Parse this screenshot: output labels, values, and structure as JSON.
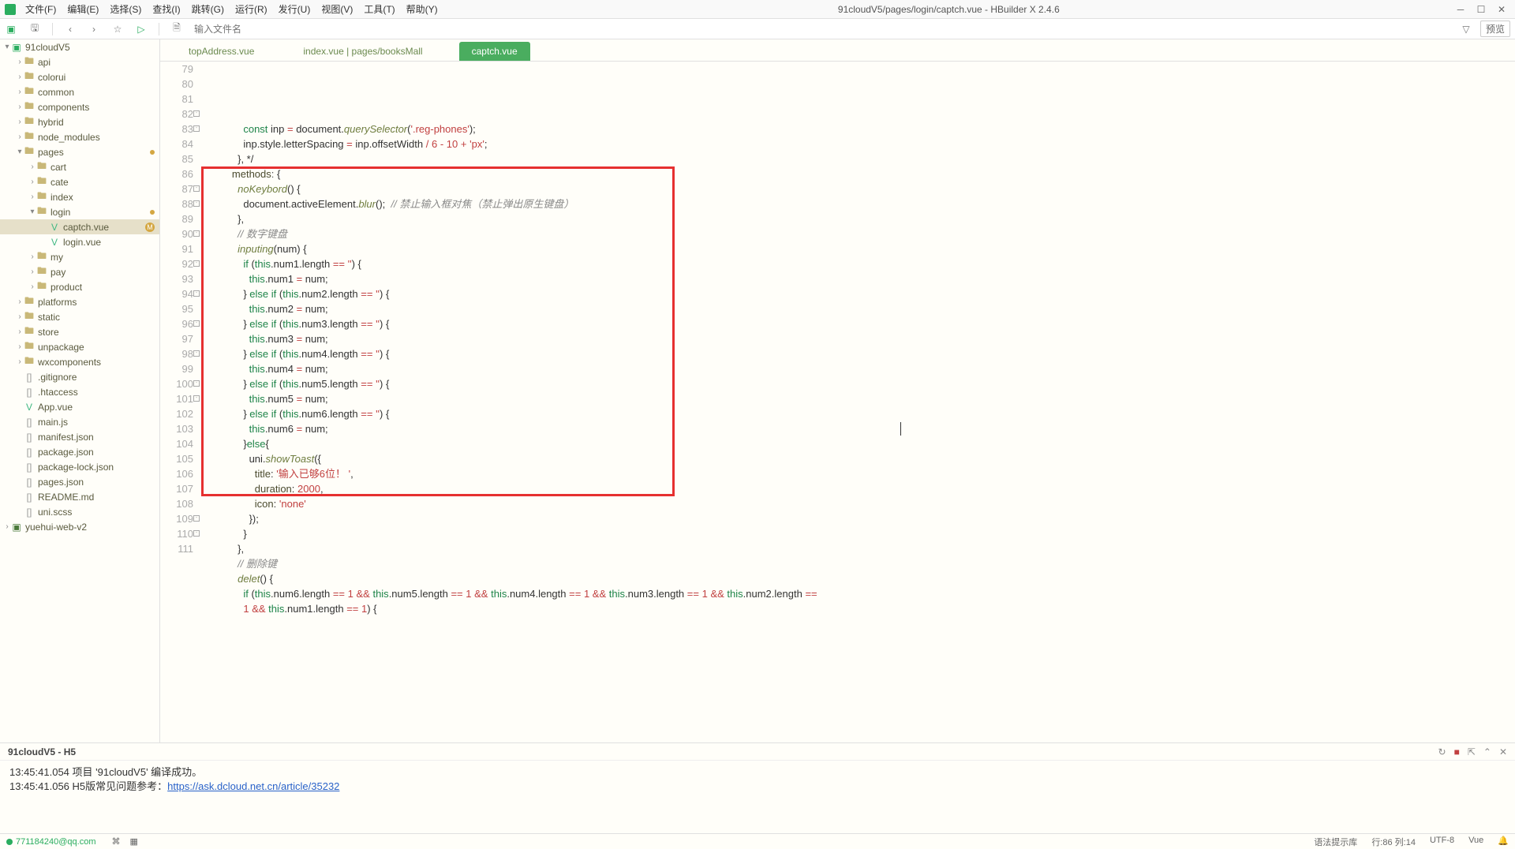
{
  "window": {
    "title": "91cloudV5/pages/login/captch.vue - HBuilder X 2.4.6"
  },
  "menu": {
    "file": "文件(F)",
    "edit": "编辑(E)",
    "select": "选择(S)",
    "find": "查找(I)",
    "goto": "跳转(G)",
    "run": "运行(R)",
    "publish": "发行(U)",
    "view": "视图(V)",
    "tools": "工具(T)",
    "help": "帮助(Y)"
  },
  "toolbar": {
    "search_placeholder": "输入文件名",
    "preview": "预览"
  },
  "tree": {
    "root": "91cloudV5",
    "api": "api",
    "colorui": "colorui",
    "common": "common",
    "components": "components",
    "hybrid": "hybrid",
    "node_modules": "node_modules",
    "pages": "pages",
    "cart": "cart",
    "cate": "cate",
    "index": "index",
    "login": "login",
    "captch": "captch.vue",
    "loginvue": "login.vue",
    "my": "my",
    "pay": "pay",
    "product": "product",
    "platforms": "platforms",
    "static": "static",
    "store": "store",
    "unpackage": "unpackage",
    "wxcomponents": "wxcomponents",
    "gitignore": ".gitignore",
    "htaccess": ".htaccess",
    "appvue": "App.vue",
    "mainjs": "main.js",
    "manifest": "manifest.json",
    "packagejson": "package.json",
    "packagelock": "package-lock.json",
    "pagesjson": "pages.json",
    "readme": "README.md",
    "uniscss": "uni.scss",
    "yuehui": "yuehui-web-v2"
  },
  "tabs": {
    "t1": "topAddress.vue",
    "t2": "index.vue | pages/booksMall",
    "t3": "captch.vue"
  },
  "code": {
    "lines": [
      {
        "n": 79,
        "html": "            <span class='kw'>const</span> inp <span class='op'>=</span> document.<span class='fn'>querySelector</span>(<span class='str'>'.reg-phones'</span>);"
      },
      {
        "n": 80,
        "html": "            inp.style.letterSpacing <span class='op'>=</span> inp.offsetWidth <span class='op'>/</span> <span class='num'>6</span> <span class='op'>-</span> <span class='num'>10</span> <span class='op'>+</span> <span class='str'>'px'</span>;"
      },
      {
        "n": 81,
        "html": "          }, */"
      },
      {
        "n": 82,
        "fold": true,
        "html": "        <span class='prop'>methods</span><span class='punct'>:</span> {"
      },
      {
        "n": 83,
        "fold": true,
        "html": "          <span class='fn'>noKeybord</span>() {"
      },
      {
        "n": 84,
        "html": "            document.activeElement.<span class='fn'>blur</span>();  <span class='cmt'>// 禁止输入框对焦（禁止弹出原生键盘）</span>"
      },
      {
        "n": 85,
        "html": "          },"
      },
      {
        "n": 86,
        "html": "          <span class='cmt'>// 数字键盘</span>"
      },
      {
        "n": 87,
        "fold": true,
        "html": "          <span class='fn'>inputing</span>(num) {"
      },
      {
        "n": 88,
        "fold": true,
        "html": "            <span class='kw'>if</span> (<span class='this'>this</span>.num1.length <span class='op'>==</span> <span class='str'>''</span>) {"
      },
      {
        "n": 89,
        "html": "              <span class='this'>this</span>.num1 <span class='op'>=</span> num;"
      },
      {
        "n": 90,
        "fold": true,
        "html": "            } <span class='kw'>else</span> <span class='kw'>if</span> (<span class='this'>this</span>.num2.length <span class='op'>==</span> <span class='str'>''</span>) {"
      },
      {
        "n": 91,
        "html": "              <span class='this'>this</span>.num2 <span class='op'>=</span> num;"
      },
      {
        "n": 92,
        "fold": true,
        "html": "            } <span class='kw'>else</span> <span class='kw'>if</span> (<span class='this'>this</span>.num3.length <span class='op'>==</span> <span class='str'>''</span>) {"
      },
      {
        "n": 93,
        "html": "              <span class='this'>this</span>.num3 <span class='op'>=</span> num;"
      },
      {
        "n": 94,
        "fold": true,
        "html": "            } <span class='kw'>else</span> <span class='kw'>if</span> (<span class='this'>this</span>.num4.length <span class='op'>==</span> <span class='str'>''</span>) {"
      },
      {
        "n": 95,
        "html": "              <span class='this'>this</span>.num4 <span class='op'>=</span> num;"
      },
      {
        "n": 96,
        "fold": true,
        "html": "            } <span class='kw'>else</span> <span class='kw'>if</span> (<span class='this'>this</span>.num5.length <span class='op'>==</span> <span class='str'>''</span>) {"
      },
      {
        "n": 97,
        "html": "              <span class='this'>this</span>.num5 <span class='op'>=</span> num;"
      },
      {
        "n": 98,
        "fold": true,
        "html": "            } <span class='kw'>else</span> <span class='kw'>if</span> (<span class='this'>this</span>.num6.length <span class='op'>==</span> <span class='str'>''</span>) {"
      },
      {
        "n": 99,
        "html": "              <span class='this'>this</span>.num6 <span class='op'>=</span> num;"
      },
      {
        "n": 100,
        "fold": true,
        "html": "            }<span class='kw'>else</span>{"
      },
      {
        "n": 101,
        "fold": true,
        "html": "              uni.<span class='fn'>showToast</span>({"
      },
      {
        "n": 102,
        "html": "                <span class='prop'>title</span>: <span class='str'>'输入已够6位！ '</span>,"
      },
      {
        "n": 103,
        "html": "                <span class='prop'>duration</span>: <span class='num'>2000</span>,"
      },
      {
        "n": 104,
        "html": "                <span class='prop'>icon</span>: <span class='str'>'none'</span>"
      },
      {
        "n": 105,
        "html": "              });"
      },
      {
        "n": 106,
        "html": "            }"
      },
      {
        "n": 107,
        "html": "          },"
      },
      {
        "n": 108,
        "html": "          <span class='cmt'>// 删除键</span>"
      },
      {
        "n": 109,
        "fold": true,
        "html": "          <span class='fn'>delet</span>() {"
      },
      {
        "n": 110,
        "fold": true,
        "html": "            <span class='kw'>if</span> (<span class='this'>this</span>.num6.length <span class='op'>==</span> <span class='num'>1</span> <span class='op'>&&</span> <span class='this'>this</span>.num5.length <span class='op'>==</span> <span class='num'>1</span> <span class='op'>&&</span> <span class='this'>this</span>.num4.length <span class='op'>==</span> <span class='num'>1</span> <span class='op'>&&</span> <span class='this'>this</span>.num3.length <span class='op'>==</span> <span class='num'>1</span> <span class='op'>&&</span> <span class='this'>this</span>.num2.length <span class='op'>==</span>"
      },
      {
        "n": 111,
        "html": "            <span class='num'>1</span> <span class='op'>&&</span> <span class='this'>this</span>.num1.length <span class='op'>==</span> <span class='num'>1</span>) {"
      }
    ]
  },
  "console": {
    "title": "91cloudV5 - H5",
    "line1_time": "13:45:41.054",
    "line1_text": "项目 '91cloudV5' 编译成功。",
    "line2_time": "13:45:41.056",
    "line2_text": "H5版常见问题参考：",
    "line2_link": "https://ask.dcloud.net.cn/article/35232"
  },
  "status": {
    "user": "771184240@qq.com",
    "syntax": "语法提示库",
    "pos": "行:86  列:14",
    "encoding": "UTF-8",
    "lang": "Vue"
  }
}
